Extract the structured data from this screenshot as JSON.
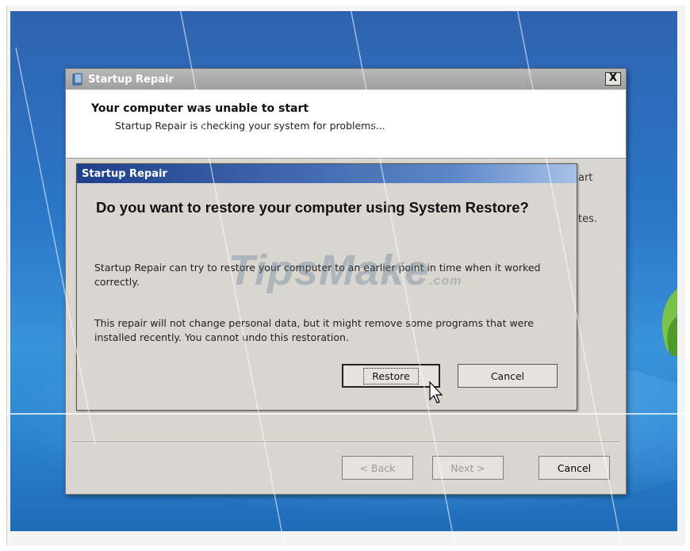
{
  "outer_window": {
    "title": "Startup Repair",
    "close_label": "X",
    "header_title": "Your computer was unable to start",
    "header_subtitle": "Startup Repair is checking your system for problems...",
    "side_text_1": "art",
    "side_text_2": "tes.",
    "buttons": {
      "back": "< Back",
      "next": "Next >",
      "cancel": "Cancel"
    }
  },
  "dialog": {
    "title": "Startup Repair",
    "question": "Do you want to restore your computer using System Restore?",
    "paragraph_1": "Startup Repair can try to restore your computer to an earlier point in time when it worked correctly.",
    "paragraph_2": "This repair will not change personal data, but it might remove some programs that were installed recently. You cannot undo this restoration.",
    "restore_label": "Restore",
    "cancel_label": "Cancel"
  },
  "watermark": {
    "text": "TipsMake",
    "suffix": ".com"
  },
  "colors": {
    "desktop_blue": "#2a78c8",
    "dialog_title_blue": "#1e3f8c",
    "window_face": "#d9d6cf"
  },
  "icons": [
    "app-icon",
    "close-icon",
    "mouse-cursor-icon",
    "leaf-icon"
  ]
}
